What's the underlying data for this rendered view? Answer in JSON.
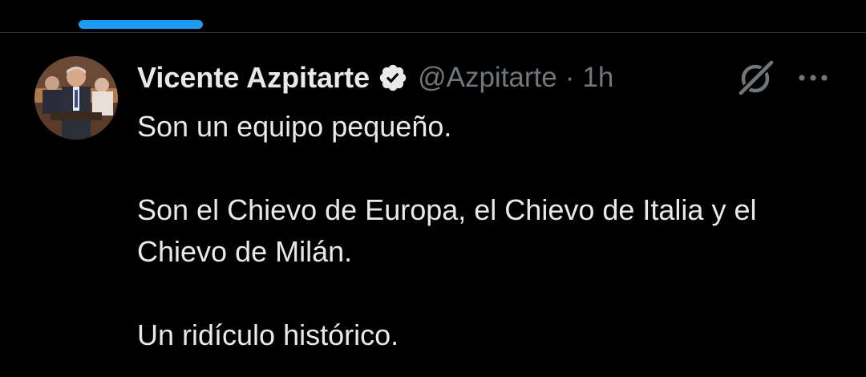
{
  "tweet": {
    "author_name": "Vicente Azpitarte",
    "handle": "@Azpitarte",
    "separator": "·",
    "time": "1h",
    "paragraphs": [
      "Son un equipo pequeño.",
      "Son el Chievo de Europa, el Chievo de Italia y el Chievo de Milán.",
      "Un ridículo histórico."
    ]
  },
  "icons": {
    "verified": "verified-badge-icon",
    "grok": "grok-icon",
    "more": "more-options-icon"
  },
  "colors": {
    "background": "#000000",
    "text": "#e7e9ea",
    "secondary_text": "#71767b",
    "accent": "#1d9bf0",
    "divider": "#2f3336"
  }
}
